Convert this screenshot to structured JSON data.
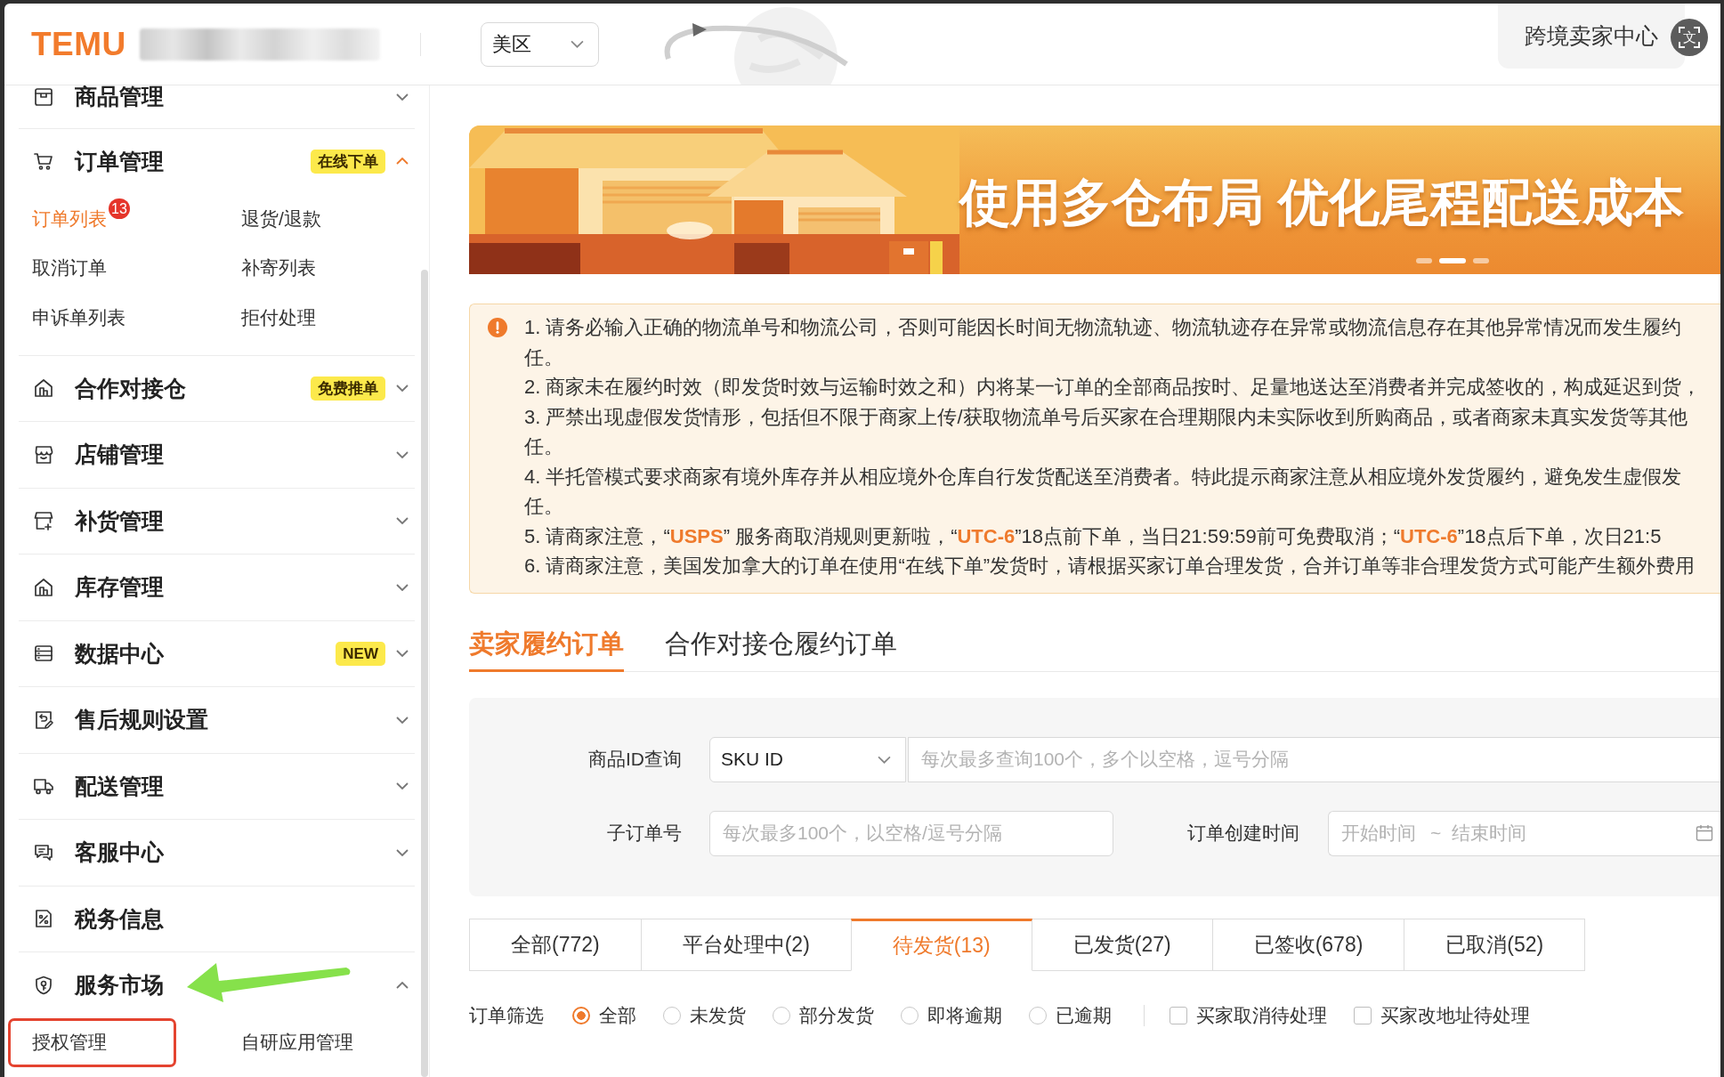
{
  "header": {
    "logo": "TEMU",
    "region_select": {
      "value": "美区"
    },
    "seller_center": "跨境卖家中心",
    "translate_button": "文"
  },
  "sidebar": {
    "items": [
      {
        "label": "商品管理",
        "expanded": false,
        "annotated": false
      },
      {
        "label": "订单管理",
        "tag": "在线下单",
        "expanded": true,
        "annotated": false,
        "children": [
          {
            "label": "订单列表",
            "selected": true,
            "badge": "13",
            "highlighted": false
          },
          {
            "label": "退货/退款",
            "selected": false,
            "highlighted": false
          },
          {
            "label": "取消订单",
            "selected": false,
            "highlighted": false
          },
          {
            "label": "补寄列表",
            "selected": false,
            "highlighted": false
          },
          {
            "label": "申诉单列表",
            "selected": false,
            "highlighted": false
          },
          {
            "label": "拒付处理",
            "selected": false,
            "highlighted": false
          }
        ]
      },
      {
        "label": "合作对接仓",
        "tag": "免费推单",
        "expanded": false,
        "annotated": false
      },
      {
        "label": "店铺管理",
        "expanded": false,
        "annotated": false
      },
      {
        "label": "补货管理",
        "expanded": false,
        "annotated": false
      },
      {
        "label": "库存管理",
        "expanded": false,
        "annotated": false
      },
      {
        "label": "数据中心",
        "tag": "NEW",
        "expanded": false,
        "annotated": false
      },
      {
        "label": "售后规则设置",
        "expanded": false,
        "annotated": false
      },
      {
        "label": "配送管理",
        "expanded": false,
        "annotated": false
      },
      {
        "label": "客服中心",
        "expanded": false,
        "annotated": false
      },
      {
        "label": "税务信息",
        "annotated": false
      },
      {
        "label": "服务市场",
        "expanded": true,
        "annotated": true,
        "children": [
          {
            "label": "授权管理",
            "selected": false,
            "highlighted": true
          },
          {
            "label": "自研应用管理",
            "selected": false,
            "highlighted": false
          }
        ]
      }
    ]
  },
  "banner": {
    "headline": "使用多仓布局 优化尾程配送成本",
    "dots": [
      {
        "selected": false
      },
      {
        "selected": true
      },
      {
        "selected": false
      }
    ]
  },
  "notice": {
    "items": [
      {
        "lines": [
          "1. 请务必输入正确的物流单号和物流公司，否则可能因长时间无物流轨迹、物流轨迹存在异常或物流信息存在其他异常情况而发生履约",
          "任。"
        ]
      },
      {
        "lines": [
          "2. 商家未在履约时效（即发货时效与运输时效之和）内将某一订单的全部商品按时、足量地送达至消费者并完成签收的，构成延迟到货，"
        ]
      },
      {
        "lines": [
          "3. 严禁出现虚假发货情形，包括但不限于商家上传/获取物流单号后买家在合理期限内未实际收到所购商品，或者商家未真实发货等其他",
          "任。"
        ]
      },
      {
        "lines": [
          "4. 半托管模式要求商家有境外库存并从相应境外仓库自行发货配送至消费者。特此提示商家注意从相应境外发货履约，避免发生虚假发",
          "任。"
        ]
      },
      {
        "lines": [
          "5. 请商家注意，“**USPS**” 服务商取消规则更新啦，“**UTC-6**”18点前下单，当日21:59:59前可免费取消；“**UTC-6**”18点后下单，次日21:5"
        ]
      },
      {
        "lines": [
          "6. 请商家注意，美国发加拿大的订单在使用“在线下单”发货时，请根据买家订单合理发货，合并订单等非合理发货方式可能产生额外费用"
        ]
      }
    ]
  },
  "order_tabs": [
    {
      "label": "卖家履约订单",
      "selected": true
    },
    {
      "label": "合作对接仓履约订单",
      "selected": false
    }
  ],
  "filters": {
    "product_id": {
      "label": "商品ID查询",
      "type_select": "SKU ID",
      "placeholder": "每次最多查询100个，多个以空格，逗号分隔"
    },
    "sub_order": {
      "label": "子订单号",
      "placeholder": "每次最多100个，以空格/逗号分隔"
    },
    "created_time": {
      "label": "订单创建时间",
      "start_placeholder": "开始时间",
      "separator": "~",
      "end_placeholder": "结束时间"
    }
  },
  "status_tabs": [
    {
      "label": "全部(772)",
      "selected": false
    },
    {
      "label": "平台处理中(2)",
      "selected": false
    },
    {
      "label": "待发货(13)",
      "selected": true
    },
    {
      "label": "已发货(27)",
      "selected": false
    },
    {
      "label": "已签收(678)",
      "selected": false
    },
    {
      "label": "已取消(52)",
      "selected": false
    }
  ],
  "order_filter": {
    "label": "订单筛选",
    "radios": [
      {
        "label": "全部",
        "selected": true
      },
      {
        "label": "未发货",
        "selected": false
      },
      {
        "label": "部分发货",
        "selected": false
      },
      {
        "label": "即将逾期",
        "selected": false
      },
      {
        "label": "已逾期",
        "selected": false
      }
    ],
    "checkboxes": [
      {
        "label": "买家取消待处理",
        "checked": false
      },
      {
        "label": "买家改地址待处理",
        "checked": false
      }
    ]
  }
}
